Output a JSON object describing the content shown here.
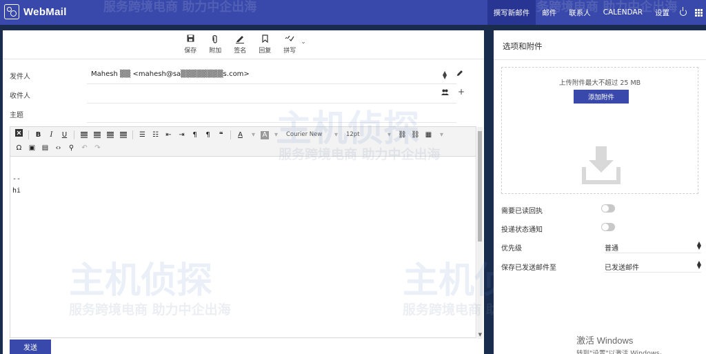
{
  "app": {
    "title": "WebMail"
  },
  "nav": [
    {
      "label": "撰写新邮件",
      "active": true
    },
    {
      "label": "邮件"
    },
    {
      "label": "联系人"
    },
    {
      "label": "CALENDAR"
    },
    {
      "label": "设置"
    }
  ],
  "toolbar": {
    "save": "保存",
    "attach": "附加",
    "signature": "签名",
    "reply": "回复",
    "spell": "拼写"
  },
  "form": {
    "from_label": "发件人",
    "from_value": "Mahesh ▒▒ <mahesh@sa▒▒▒▒▒▒▒▒s.com>",
    "to_label": "收件人",
    "to_value": "",
    "subject_label": "主题",
    "subject_value": ""
  },
  "format": {
    "font": "Courier New",
    "size": "12pt"
  },
  "body": {
    "line1": "--",
    "line2": "hi"
  },
  "send_label": "发送",
  "options": {
    "title": "选项和附件",
    "upload_limit": "上传附件最大不超过 25 MB",
    "add_attachment": "添加附件",
    "read_receipt": "需要已读回执",
    "delivery_status": "投递状态通知",
    "priority_label": "优先级",
    "priority_value": "普通",
    "save_sent_label": "保存已发送邮件至",
    "save_sent_value": "已发送邮件"
  },
  "windows_notice": {
    "title": "激活 Windows",
    "hint": "转到\"设置\"以激活 Windows。"
  },
  "watermark": {
    "brand": "主机侦探",
    "slogan": "服务跨境电商 助力中企出海"
  },
  "colors": {
    "accent": "#3949ab",
    "accent_dark": "#283593",
    "background": "#1a2c4d"
  }
}
